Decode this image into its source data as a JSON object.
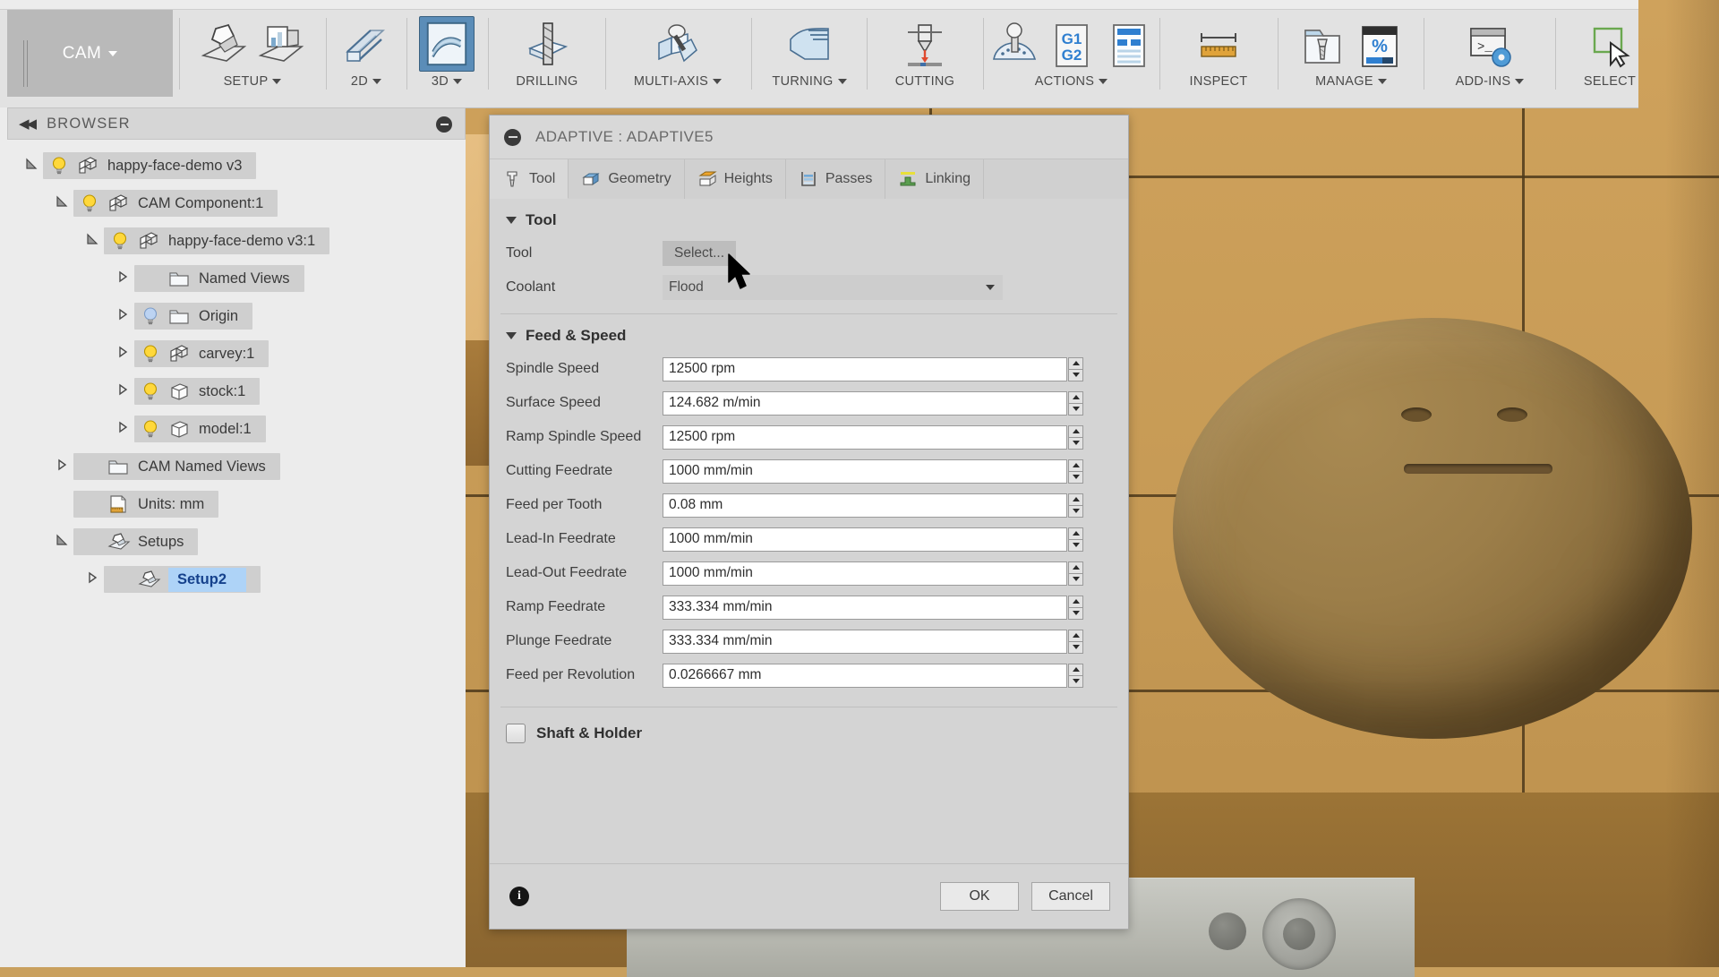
{
  "ribbon": {
    "workspace": {
      "label": "CAM",
      "has_dropdown": true
    },
    "panels": [
      {
        "label": "SETUP",
        "dropdown": true,
        "icons": [
          "setup-icon",
          "setup-folder-icon"
        ]
      },
      {
        "label": "2D",
        "dropdown": true,
        "icons": [
          "milling-2d-icon"
        ]
      },
      {
        "label": "3D",
        "dropdown": true,
        "icons": [
          "milling-3d-icon"
        ],
        "selected": true
      },
      {
        "label": "DRILLING",
        "dropdown": false,
        "icons": [
          "drilling-icon"
        ]
      },
      {
        "label": "MULTI-AXIS",
        "dropdown": true,
        "icons": [
          "multi-axis-icon"
        ]
      },
      {
        "label": "TURNING",
        "dropdown": true,
        "icons": [
          "turning-icon"
        ]
      },
      {
        "label": "CUTTING",
        "dropdown": false,
        "icons": [
          "cutting-icon"
        ]
      },
      {
        "label": "ACTIONS",
        "dropdown": true,
        "icons": [
          "simulate-icon",
          "g1g2-post-process-icon",
          "setup-sheet-icon"
        ]
      },
      {
        "label": "INSPECT",
        "dropdown": false,
        "icons": [
          "measure-ruler-icon"
        ]
      },
      {
        "label": "MANAGE",
        "dropdown": true,
        "icons": [
          "tool-library-icon",
          "percent-machine-icon"
        ]
      },
      {
        "label": "ADD-INS",
        "dropdown": true,
        "icons": [
          "script-addin-icon"
        ]
      },
      {
        "label": "SELECT",
        "dropdown": false,
        "icons": [
          "select-arrow-icon"
        ]
      }
    ]
  },
  "browser": {
    "title": "BROWSER",
    "collapse_icon": "collapse-left-icon",
    "minimize_icon": "minus-circle-icon",
    "tree": [
      {
        "label": "happy-face-demo v3",
        "indent": 0,
        "twist": "open",
        "bulb": "yellow",
        "icon": "component-icon",
        "selected": false
      },
      {
        "label": "CAM Component:1",
        "indent": 1,
        "twist": "open",
        "bulb": "yellow",
        "icon": "component-icon",
        "selected": false
      },
      {
        "label": "happy-face-demo v3:1",
        "indent": 2,
        "twist": "open",
        "bulb": "yellow",
        "icon": "component-icon",
        "selected": false
      },
      {
        "label": "Named Views",
        "indent": 3,
        "twist": "closed",
        "bulb": "none",
        "icon": "folder-icon",
        "selected": false
      },
      {
        "label": "Origin",
        "indent": 3,
        "twist": "closed",
        "bulb": "blue",
        "icon": "folder-icon",
        "selected": false
      },
      {
        "label": "carvey:1",
        "indent": 3,
        "twist": "closed",
        "bulb": "yellow",
        "icon": "component-icon",
        "selected": false
      },
      {
        "label": "stock:1",
        "indent": 3,
        "twist": "closed",
        "bulb": "yellow",
        "icon": "body-icon",
        "selected": false
      },
      {
        "label": "model:1",
        "indent": 3,
        "twist": "closed",
        "bulb": "yellow",
        "icon": "body-icon",
        "selected": false
      },
      {
        "label": "CAM Named Views",
        "indent": 1,
        "twist": "closed",
        "bulb": "none",
        "icon": "folder-icon",
        "selected": false
      },
      {
        "label": "Units: mm",
        "indent": 1,
        "twist": "none",
        "bulb": "none",
        "icon": "units-doc-icon",
        "selected": false
      },
      {
        "label": "Setups",
        "indent": 1,
        "twist": "open",
        "bulb": "none",
        "icon": "setup-icon",
        "selected": false
      },
      {
        "label": "Setup2",
        "indent": 2,
        "twist": "closed",
        "bulb": "none",
        "icon": "setup-icon",
        "selected": true
      }
    ]
  },
  "dialog": {
    "title": "ADAPTIVE : ADAPTIVE5",
    "minimize_icon": "minus-circle-icon",
    "tabs": [
      {
        "label": "Tool",
        "icon": "tool-bit-icon",
        "active": true
      },
      {
        "label": "Geometry",
        "icon": "geometry-box-icon",
        "active": false
      },
      {
        "label": "Heights",
        "icon": "heights-icon",
        "active": false
      },
      {
        "label": "Passes",
        "icon": "passes-icon",
        "active": false
      },
      {
        "label": "Linking",
        "icon": "linking-icon",
        "active": false
      }
    ],
    "tool_section": {
      "heading": "Tool",
      "tool_label": "Tool",
      "tool_button": "Select...",
      "coolant_label": "Coolant",
      "coolant_value": "Flood"
    },
    "feed_speed_section": {
      "heading": "Feed & Speed",
      "fields": [
        {
          "label": "Spindle Speed",
          "value": "12500 rpm"
        },
        {
          "label": "Surface Speed",
          "value": "124.682 m/min"
        },
        {
          "label": "Ramp Spindle Speed",
          "value": "12500 rpm"
        },
        {
          "label": "Cutting Feedrate",
          "value": "1000 mm/min"
        },
        {
          "label": "Feed per Tooth",
          "value": "0.08 mm"
        },
        {
          "label": "Lead-In Feedrate",
          "value": "1000 mm/min"
        },
        {
          "label": "Lead-Out Feedrate",
          "value": "1000 mm/min"
        },
        {
          "label": "Ramp Feedrate",
          "value": "333.334 mm/min"
        },
        {
          "label": "Plunge Feedrate",
          "value": "333.334 mm/min"
        },
        {
          "label": "Feed per Revolution",
          "value": "0.0266667 mm"
        }
      ]
    },
    "shaft_holder": {
      "label": "Shaft & Holder",
      "checked": false
    },
    "footer": {
      "info_icon": "info-icon",
      "info_glyph": "i",
      "ok_label": "OK",
      "cancel_label": "Cancel"
    }
  },
  "colors": {
    "accent_selected": "#aed3f7",
    "selected_text": "#15418c",
    "ribbon_bg": "#e2e2e2",
    "dialog_bg": "#d4d4d4",
    "stock_wood": "#c79c55",
    "tab_highlight": "#5b8db8"
  }
}
